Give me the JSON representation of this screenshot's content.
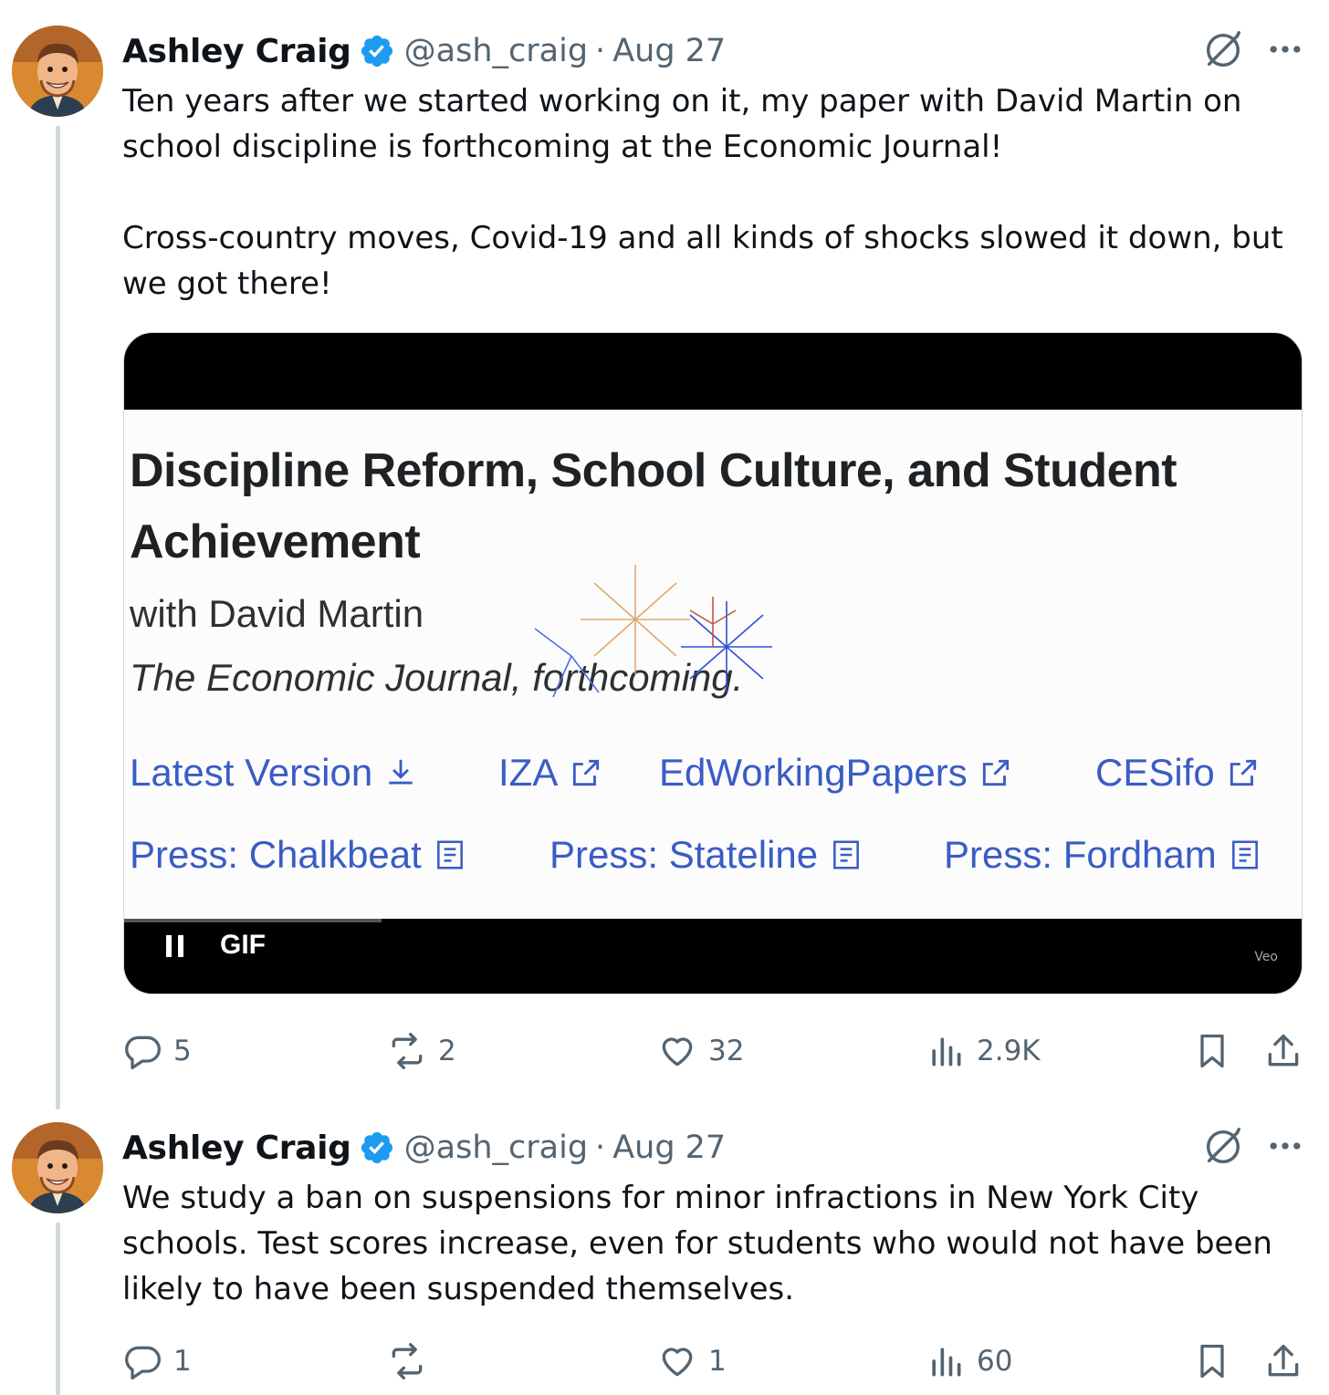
{
  "tweets": [
    {
      "author": {
        "name": "Ashley Craig",
        "handle": "@ash_craig",
        "date": "Aug 27",
        "separator": "·"
      },
      "text": [
        "Ten years after we started working on it, my paper with David Martin on school discipline is forthcoming at the Economic Journal!",
        "Cross-country moves, Covid-19 and all kinds of shocks slowed it down, but we got there!"
      ],
      "media": {
        "type": "GIF",
        "label": "GIF",
        "paper_title": "Discipline Reform, School Culture, and Student Achievement",
        "coauthor": "with David Martin",
        "journal": "The Economic Journal, forthcoming.",
        "links": [
          "Latest Version",
          "IZA",
          "EdWorkingPapers",
          "CESifo"
        ],
        "press": [
          "Press: Chalkbeat",
          "Press: Stateline",
          "Press: Fordham"
        ],
        "watermark": "Veo"
      },
      "stats": {
        "replies": "5",
        "reposts": "2",
        "likes": "32",
        "views": "2.9K"
      }
    },
    {
      "author": {
        "name": "Ashley Craig",
        "handle": "@ash_craig",
        "date": "Aug 27",
        "separator": "·"
      },
      "text": [
        "We study a ban on suspensions for minor infractions in New York City schools. Test scores increase, even for students who would not have been likely to have been suspended themselves."
      ],
      "stats": {
        "replies": "1",
        "reposts": "",
        "likes": "1",
        "views": "60"
      }
    }
  ],
  "colors": {
    "verified": "#1d9bf0",
    "link": "#3a5cc4",
    "muted": "#536471",
    "text": "#0f1419"
  }
}
